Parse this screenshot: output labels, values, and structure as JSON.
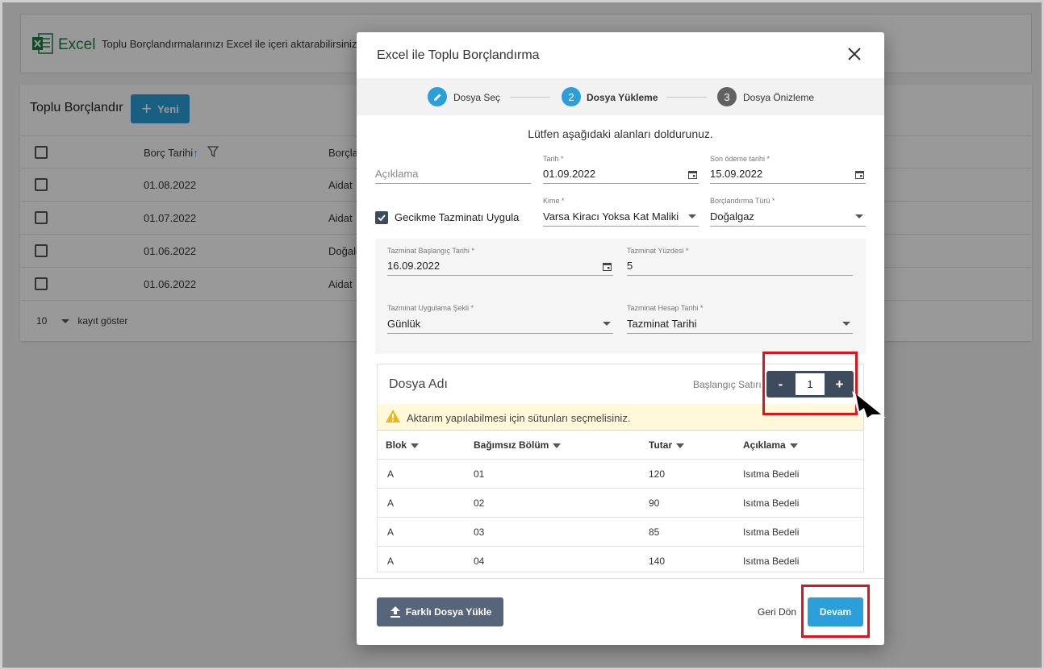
{
  "background": {
    "excel_word": "Excel",
    "excel_description": "Toplu Borçlandırmalarınızı Excel ile içeri aktarabilirsiniz",
    "list_title": "Toplu Borçlandır",
    "new_button": "Yeni",
    "columns": {
      "date": "Borç Tarihi",
      "type": "Borçlan"
    },
    "rows": [
      {
        "date": "01.08.2022",
        "type": "Aidat"
      },
      {
        "date": "01.07.2022",
        "type": "Aidat"
      },
      {
        "date": "01.06.2022",
        "type": "Doğalg"
      },
      {
        "date": "01.06.2022",
        "type": "Aidat"
      }
    ],
    "pager": {
      "count": "10",
      "label": "kayıt göster"
    }
  },
  "modal": {
    "title": "Excel ile Toplu Borçlandırma",
    "steps": [
      {
        "number": "✎",
        "label": "Dosya Seç",
        "state": "done",
        "color": "#2b9fd9"
      },
      {
        "number": "2",
        "label": "Dosya Yükleme",
        "state": "active",
        "color": "#2b9fd9"
      },
      {
        "number": "3",
        "label": "Dosya Önizleme",
        "state": "pending",
        "color": "#616161"
      }
    ],
    "instruction": "Lütfen aşağıdaki alanları doldurunuz.",
    "form": {
      "description_placeholder": "Açıklama",
      "date_label": "Tarih *",
      "date_value": "01.09.2022",
      "due_date_label": "Son ödeme tarihi *",
      "due_date_value": "15.09.2022",
      "late_fee_checkbox": "Gecikme Tazminatı Uygula",
      "late_fee_checked": true,
      "to_whom_label": "Kime *",
      "to_whom_value": "Varsa Kiracı Yoksa Kat Maliki",
      "debt_type_label": "Borçlandırma Türü *",
      "debt_type_value": "Doğalgaz",
      "comp_start_label": "Tazminat Başlangıç Tarihi *",
      "comp_start_value": "16.09.2022",
      "comp_percent_label": "Tazminat Yüzdesi *",
      "comp_percent_value": "5",
      "comp_method_label": "Tazminat Uygulama Şekli *",
      "comp_method_value": "Günlük",
      "comp_calc_label": "Tazminat Hesap Tarihi *",
      "comp_calc_value": "Tazminat Tarihi"
    },
    "file": {
      "title": "Dosya Adı",
      "start_row_label": "Başlangıç Satırı",
      "start_row_value": "1",
      "minus": "-",
      "plus": "+",
      "warning": "Aktarım yapılabilmesi için sütunları seçmelisiniz.",
      "columns": [
        "Blok",
        "Bağımsız Bölüm",
        "Tutar",
        "Açıklama"
      ],
      "rows": [
        [
          "A",
          "01",
          "120",
          "Isıtma Bedeli"
        ],
        [
          "A",
          "02",
          "90",
          "Isıtma Bedeli"
        ],
        [
          "A",
          "03",
          "85",
          "Isıtma Bedeli"
        ],
        [
          "A",
          "04",
          "140",
          "Isıtma Bedeli"
        ]
      ]
    },
    "footer": {
      "upload_button": "Farklı Dosya Yükle",
      "back_link": "Geri Dön",
      "continue_button": "Devam"
    }
  },
  "colors": {
    "primary": "#2b9fd9",
    "dark": "#3d4b5c",
    "highlight": "#e0121a",
    "excel_green": "#1f7c45"
  },
  "icons": [
    "excel-icon",
    "plus-icon",
    "sort-up-icon",
    "filter-icon",
    "pencil-icon",
    "close-icon",
    "calendar-icon",
    "check-icon",
    "warning-icon",
    "upload-icon",
    "cursor-arrow-icon"
  ]
}
